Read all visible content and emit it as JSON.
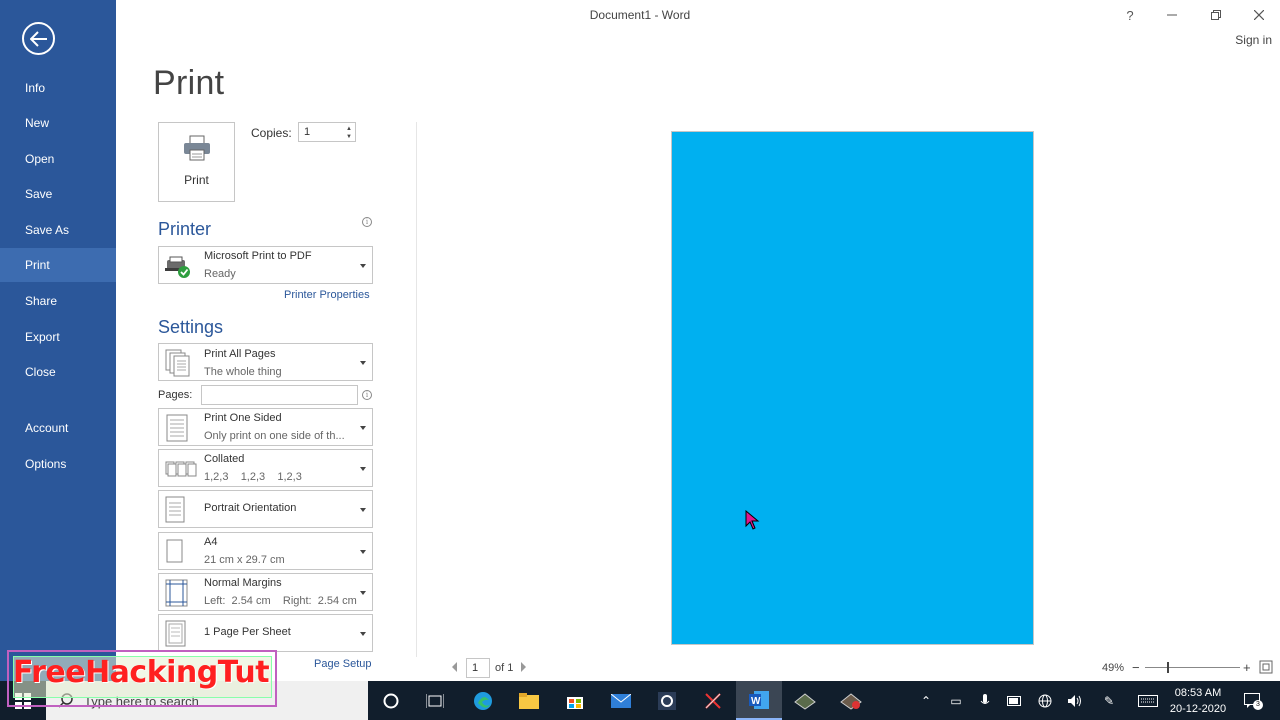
{
  "window": {
    "title": "Document1 - Word",
    "help": "?",
    "sign_in": "Sign in"
  },
  "sidebar": {
    "items": [
      {
        "label": "Info"
      },
      {
        "label": "New"
      },
      {
        "label": "Open"
      },
      {
        "label": "Save"
      },
      {
        "label": "Save As"
      },
      {
        "label": "Print",
        "active": true
      },
      {
        "label": "Share"
      },
      {
        "label": "Export"
      },
      {
        "label": "Close"
      },
      {
        "label": "Account"
      },
      {
        "label": "Options"
      }
    ]
  },
  "print": {
    "heading": "Print",
    "button_label": "Print",
    "copies_label": "Copies:",
    "copies_value": "1"
  },
  "printer": {
    "heading": "Printer",
    "name": "Microsoft Print to PDF",
    "status": "Ready",
    "properties_link": "Printer Properties"
  },
  "settings": {
    "heading": "Settings",
    "pages_label": "Pages:",
    "pages_value": "",
    "items": [
      {
        "title": "Print All Pages",
        "sub": "The whole thing"
      },
      {
        "title": "Print One Sided",
        "sub": "Only print on one side of th..."
      },
      {
        "title": "Collated",
        "sub": "1,2,3    1,2,3    1,2,3"
      },
      {
        "title": "Portrait Orientation",
        "sub": ""
      },
      {
        "title": "A4",
        "sub": "21 cm x 29.7 cm"
      },
      {
        "title": "Normal Margins",
        "sub": "Left:  2.54 cm    Right:  2.54 cm"
      },
      {
        "title": "1 Page Per Sheet",
        "sub": ""
      }
    ],
    "page_setup_link": "Page Setup"
  },
  "preview": {
    "page_color": "#00b0f0",
    "current_page": "1",
    "of_pages": "of 1",
    "zoom": "49%"
  },
  "taskbar": {
    "search_placeholder": "Type here to search",
    "time": "08:53 AM",
    "date": "20-12-2020",
    "notification_count": "3"
  },
  "watermark": {
    "text": "FreeHackingTut"
  },
  "colors": {
    "accent": "#2b579a",
    "taskbar": "#111e2c"
  }
}
